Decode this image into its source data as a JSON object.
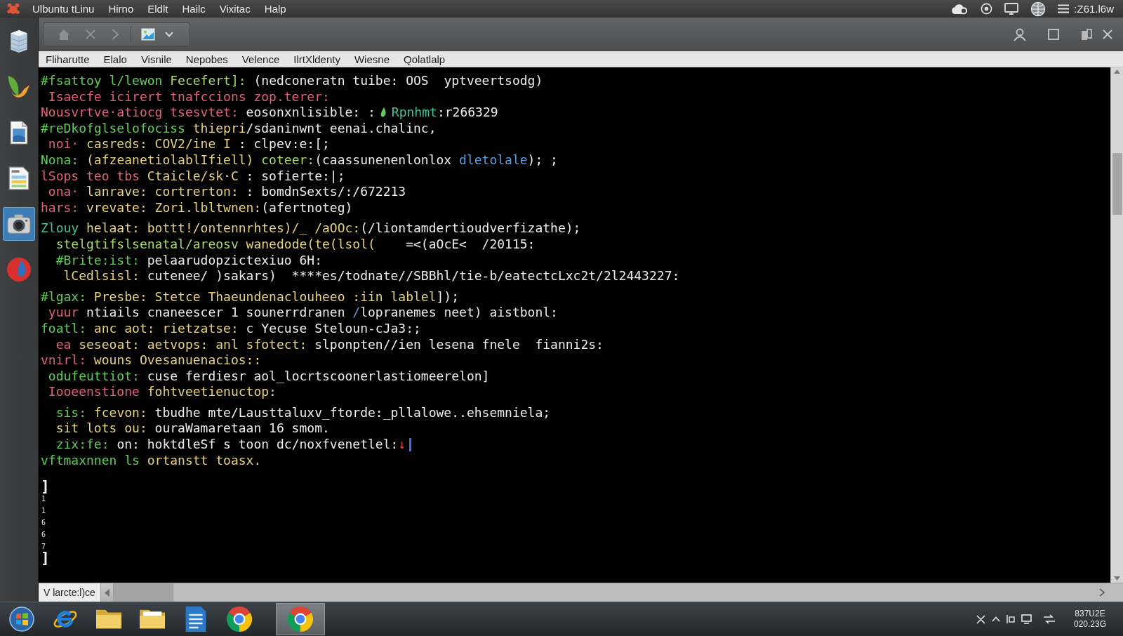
{
  "top_panel": {
    "app_name": "Ulbuntu tLinu",
    "menus": [
      "Hirno",
      "Eldlt",
      "Hailc",
      "Vixitac",
      "Halp"
    ],
    "status_text": ":Z61.l6w"
  },
  "dock": {
    "items": [
      {
        "selected": false
      },
      {
        "selected": false
      },
      {
        "selected": false
      },
      {
        "selected": false
      },
      {
        "selected": true
      },
      {
        "selected": false
      }
    ]
  },
  "window": {
    "menu": [
      "Fliharutte",
      "Elalo",
      "Visnile",
      "Nepobes",
      "Velence",
      "IlrtXldenty",
      "Wiesne",
      "Qolatlalp"
    ],
    "terminal": {
      "blocks": [
        [
          {
            "segments": [
              {
                "kind": "text",
                "text": "#fsattoy l/lewon ",
                "color": "#5fcc55"
              },
              {
                "kind": "text",
                "text": "Fecefert]: ",
                "color": "#a6dc6a"
              },
              {
                "kind": "text",
                "text": "(nedconeratn tuibe: OOS  yptveertsodg)",
                "color": "#ececec"
              }
            ]
          },
          {
            "segments": [
              {
                "kind": "text",
                "text": " Isaecfe icirert tnafccions zop.terer:",
                "color": "#e0607a"
              }
            ]
          },
          {
            "segments": [
              {
                "kind": "text",
                "text": "Nousvrtve·atiocg tsesvtet: ",
                "color": "#e0607a"
              },
              {
                "kind": "text",
                "text": "eosonxnlisible: :",
                "color": "#ececec"
              },
              {
                "kind": "drop",
                "color": "#5fcc55"
              },
              {
                "kind": "text",
                "text": "Rpnhmt",
                "color": "#3fc1a0"
              },
              {
                "kind": "text",
                "text": ":r266329",
                "color": "#ececec"
              }
            ]
          },
          {
            "segments": [
              {
                "kind": "text",
                "text": "#reDkofglselofociss ",
                "color": "#5fcc55"
              },
              {
                "kind": "text",
                "text": "thiepri",
                "color": "#e6d27a"
              },
              {
                "kind": "text",
                "text": "/sdaninwnt eenai.chalinc,",
                "color": "#ececec"
              }
            ]
          },
          {
            "segments": [
              {
                "kind": "text",
                "text": " noi·",
                "color": "#e0607a"
              },
              {
                "kind": "text",
                "text": " casreds: COV2/ine I",
                "color": "#e6d27a"
              },
              {
                "kind": "text",
                "text": " : clpev:e:[;",
                "color": "#ececec"
              }
            ]
          },
          {
            "segments": [
              {
                "kind": "text",
                "text": "Nona: ",
                "color": "#5fcc55"
              },
              {
                "kind": "text",
                "text": "(afzeanetiolablIfiell) ",
                "color": "#e6d27a"
              },
              {
                "kind": "text",
                "text": "coteer:",
                "color": "#a6dc6a"
              },
              {
                "kind": "text",
                "text": "(caassunenenlonlox ",
                "color": "#ececec"
              },
              {
                "kind": "text",
                "text": "dletolale",
                "color": "#5b9fe0"
              },
              {
                "kind": "text",
                "text": "); ;",
                "color": "#ececec"
              }
            ]
          },
          {
            "segments": [
              {
                "kind": "text",
                "text": "lSops teo tbs ",
                "color": "#e0607a"
              },
              {
                "kind": "text",
                "text": "Ctaicle/sk·C",
                "color": "#e6d27a"
              },
              {
                "kind": "text",
                "text": " : sofierte:|;",
                "color": "#ececec"
              }
            ]
          },
          {
            "segments": [
              {
                "kind": "text",
                "text": " ona·",
                "color": "#e0607a"
              },
              {
                "kind": "text",
                "text": " lanrave: cortrerton:",
                "color": "#e6d27a"
              },
              {
                "kind": "text",
                "text": " : bomdnSexts/:/672213",
                "color": "#ececec"
              }
            ]
          },
          {
            "segments": [
              {
                "kind": "text",
                "text": "hars:",
                "color": "#e0607a"
              },
              {
                "kind": "text",
                "text": " vrevate: Zori.lbltwnen:",
                "color": "#e6d27a"
              },
              {
                "kind": "text",
                "text": "(afertnoteg)",
                "color": "#ececec"
              }
            ]
          }
        ],
        [
          {
            "segments": [
              {
                "kind": "text",
                "text": "Zlouy",
                "color": "#3fc1a0"
              },
              {
                "kind": "text",
                "text": " helaat: bottt!/ontennrhtes)/_ /aOOc:",
                "color": "#e6d27a"
              },
              {
                "kind": "text",
                "text": "(/liontamdertioudverfizathe);",
                "color": "#ececec"
              }
            ]
          },
          {
            "segments": [
              {
                "kind": "text",
                "text": "  stelgtifslsenatal/areosv ",
                "color": "#a6dc6a"
              },
              {
                "kind": "text",
                "text": "wanedode(te(lsol(",
                "color": "#e6d27a"
              },
              {
                "kind": "text",
                "text": "    =<(aOcE<  /20115:",
                "color": "#ececec"
              }
            ]
          },
          {
            "segments": [
              {
                "kind": "text",
                "text": "  #Brite:ist: ",
                "color": "#5fcc55"
              },
              {
                "kind": "text",
                "text": "pelaarudopzictexiuo 6H:",
                "color": "#ececec"
              }
            ]
          },
          {
            "segments": [
              {
                "kind": "text",
                "text": "   lCedlsisl: ",
                "color": "#e6d27a"
              },
              {
                "kind": "text",
                "text": "cutenee/ )sakars)  ****es/todnate//SBBhl/tie-b/eatectcLxc2t/2l2443227:",
                "color": "#ececec"
              }
            ]
          }
        ],
        [
          {
            "segments": [
              {
                "kind": "text",
                "text": "#lgax: ",
                "color": "#5fcc55"
              },
              {
                "kind": "text",
                "text": "Presbe: Stetce Thaeundenaclouheeo :iin lablel",
                "color": "#e6d27a"
              },
              {
                "kind": "text",
                "text": "]);",
                "color": "#ececec"
              }
            ]
          },
          {
            "segments": [
              {
                "kind": "text",
                "text": " yuur",
                "color": "#e0607a"
              },
              {
                "kind": "text",
                "text": " ntiails cnaneescer 1 sounerrdranen ",
                "color": "#ececec"
              },
              {
                "kind": "text",
                "text": "/",
                "color": "#5b9fe0"
              },
              {
                "kind": "text",
                "text": "lopranemes neet) aistbonl:",
                "color": "#ececec"
              }
            ]
          },
          {
            "segments": [
              {
                "kind": "text",
                "text": "foatl:",
                "color": "#5fcc55"
              },
              {
                "kind": "text",
                "text": " anc aot: rietzatse:",
                "color": "#e6d27a"
              },
              {
                "kind": "text",
                "text": " c Yecuse Steloun-cJa3:;",
                "color": "#ececec"
              }
            ]
          },
          {
            "segments": [
              {
                "kind": "text",
                "text": "  ea",
                "color": "#e0607a"
              },
              {
                "kind": "text",
                "text": " seseoat: aetvops: anl sfotect:",
                "color": "#e6d27a"
              },
              {
                "kind": "text",
                "text": " slponpten//ien lesena fnele  fianni2s:",
                "color": "#ececec"
              }
            ]
          },
          {
            "segments": [
              {
                "kind": "text",
                "text": "vnirl:",
                "color": "#e0607a"
              },
              {
                "kind": "text",
                "text": " wouns Ovesanuenacios::",
                "color": "#e6d27a"
              }
            ]
          },
          {
            "segments": [
              {
                "kind": "text",
                "text": " odufeuttiot:",
                "color": "#5fcc55"
              },
              {
                "kind": "text",
                "text": " cuse ferdiesr aol_locrtscoonerlastiomeerelon]",
                "color": "#ececec"
              }
            ]
          },
          {
            "segments": [
              {
                "kind": "text",
                "text": " Iooeenstione",
                "color": "#e0607a"
              },
              {
                "kind": "text",
                "text": " fohtveetienuctop:",
                "color": "#e6d27a"
              }
            ]
          }
        ],
        [
          {
            "segments": [
              {
                "kind": "text",
                "text": "  sis:",
                "color": "#5fcc55"
              },
              {
                "kind": "text",
                "text": " fcevon:",
                "color": "#e6d27a"
              },
              {
                "kind": "text",
                "text": " tbudhe mte/Lausttaluxv_ftorde:_pllalowe..ehsemniela;",
                "color": "#ececec"
              }
            ]
          },
          {
            "segments": [
              {
                "kind": "text",
                "text": "  sit lots ou:",
                "color": "#e6d27a"
              },
              {
                "kind": "text",
                "text": " ouraWamaretaan 16 smom.",
                "color": "#ececec"
              }
            ]
          },
          {
            "segments": [
              {
                "kind": "text",
                "text": "  zix:fe:",
                "color": "#5fcc55"
              },
              {
                "kind": "text",
                "text": " on: hoktdleSf s toon dc/noxfvenetlel:",
                "color": "#ececec"
              },
              {
                "kind": "text",
                "text": "↓",
                "color": "#e04040"
              },
              {
                "kind": "cursor",
                "color": "#3f6fe0"
              }
            ]
          },
          {
            "segments": [
              {
                "kind": "text",
                "text": "vftmaxnnen ls",
                "color": "#5fcc55"
              },
              {
                "kind": "text",
                "text": " ortanstt toasx.",
                "color": "#e6d27a"
              }
            ]
          }
        ]
      ],
      "gutter": [
        {
          "kind": "bracket",
          "text": "]"
        },
        {
          "kind": "mark",
          "text": "1"
        },
        {
          "kind": "mark",
          "text": "1"
        },
        {
          "kind": "mark",
          "text": "6"
        },
        {
          "kind": "mark",
          "text": "6"
        },
        {
          "kind": "mark",
          "text": "7"
        },
        {
          "kind": "bracket",
          "text": "]"
        }
      ]
    },
    "tab_label": "V larcte:l)ce"
  },
  "taskbar": {
    "items": [
      {
        "selected": false
      },
      {
        "selected": false
      },
      {
        "selected": false
      },
      {
        "selected": false
      },
      {
        "selected": false
      },
      {
        "selected": false
      },
      {
        "selected": true
      }
    ],
    "clock": {
      "time": "837U2E",
      "date": "020.23G"
    }
  }
}
